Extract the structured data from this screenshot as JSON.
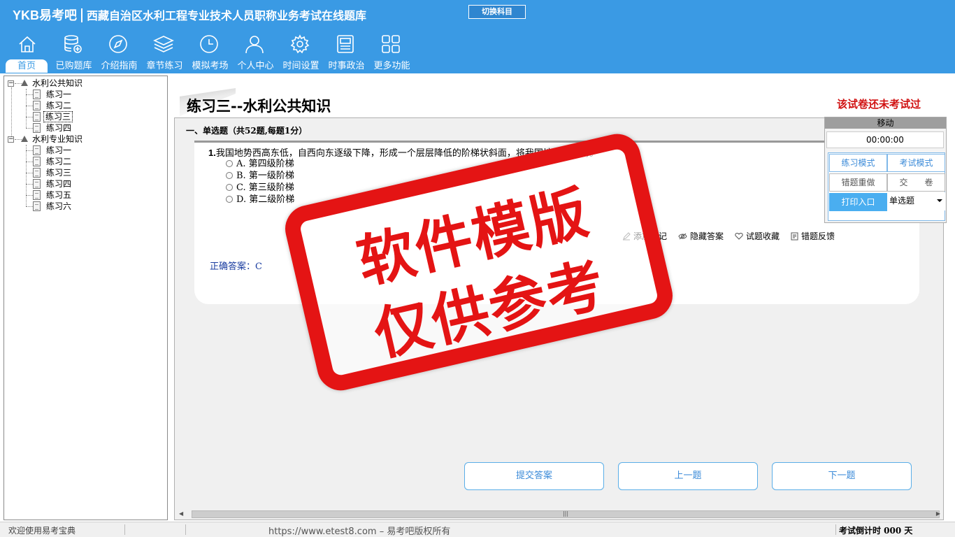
{
  "header": {
    "brand": "YKB易考吧",
    "app_title": "西藏自治区水利工程专业技术人员职称业务考试在线题库",
    "switch_subject": "切换科目",
    "nav": [
      {
        "label": "首页",
        "icon": "home-icon"
      },
      {
        "label": "已购题库",
        "icon": "database-icon"
      },
      {
        "label": "介绍指南",
        "icon": "compass-icon"
      },
      {
        "label": "章节练习",
        "icon": "layers-icon"
      },
      {
        "label": "模拟考场",
        "icon": "clock-icon"
      },
      {
        "label": "个人中心",
        "icon": "user-icon"
      },
      {
        "label": "时间设置",
        "icon": "gear-icon"
      },
      {
        "label": "时事政治",
        "icon": "news-icon"
      },
      {
        "label": "更多功能",
        "icon": "grid-icon"
      }
    ]
  },
  "tree": {
    "groups": [
      {
        "label": "水利公共知识",
        "items": [
          "练习一",
          "练习二",
          "练习三",
          "练习四"
        ]
      },
      {
        "label": "水利专业知识",
        "items": [
          "练习一",
          "练习二",
          "练习三",
          "练习四",
          "练习五",
          "练习六"
        ]
      }
    ],
    "selected": "水利公共知识/练习三"
  },
  "exam": {
    "title": "练习三--水利公共知识",
    "status": "该试卷还未考试过",
    "section": "一、单选题（共52题,每题1分）",
    "question_number": "1.",
    "question_text": "我国地势西高东低，自西向东逐级下降，形成一个层层降低的阶梯状斜面，将我国地势分成( )。",
    "options": [
      "A. 第四级阶梯",
      "B. 第一级阶梯",
      "C. 第三级阶梯",
      "D. 第二级阶梯"
    ],
    "tools": [
      "添加笔记",
      "隐藏答案",
      "试题收藏",
      "错题反馈"
    ],
    "answer": "正确答案：C"
  },
  "buttons": {
    "submit": "提交答案",
    "prev": "上一题",
    "next": "下一题"
  },
  "panel": {
    "move": "移动",
    "timer": "00:00:00",
    "practice_mode": "练习模式",
    "exam_mode": "考试模式",
    "redo_wrong": "错题重做",
    "hand_in": "交　　卷",
    "print": "打印入口",
    "question_type": "单选题"
  },
  "watermark": {
    "line1": "软件模版",
    "line2": "仅供参考"
  },
  "status": {
    "welcome": "欢迎使用易考宝典",
    "copyright": "https://www.etest8.com – 易考吧版权所有",
    "countdown": "考试倒计时 000 天"
  },
  "colors": {
    "header_bg": "#3a9ae4",
    "accent": "#3a8ad8",
    "status_red": "#d01010",
    "stamp_red": "#e41414"
  }
}
